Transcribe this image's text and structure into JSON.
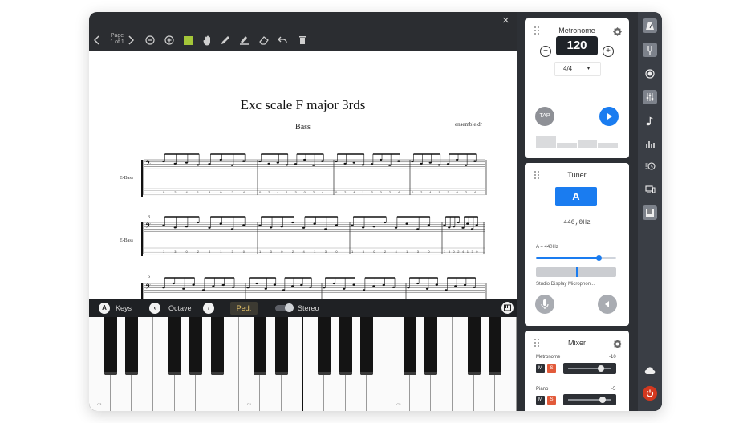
{
  "editor": {
    "page_label": "Page",
    "page_number": "1 of 1",
    "close_glyph": "×",
    "score": {
      "title": "Exc scale F major 3rds",
      "subtitle": "Bass",
      "credit": "ensemble.dr",
      "instrument_labels": [
        "E-Bass",
        "E-Bass"
      ],
      "measure_numbers": [
        "3",
        "5"
      ]
    },
    "tools": [
      "chevron-left-icon",
      "chevron-right-icon",
      "zoom-out-icon",
      "zoom-in-icon",
      "color-swatch-icon",
      "hand-icon",
      "pen-icon",
      "highlighter-icon",
      "eraser-icon",
      "undo-icon",
      "trash-icon"
    ],
    "tool_colors": {
      "swatch": "#a4c639"
    }
  },
  "piano_bar": {
    "keys_button": "A",
    "keys_label": "Keys",
    "octave_label": "Octave",
    "octave_prev": "‹",
    "octave_next": "›",
    "pedal_label": "Ped.",
    "stereo_label": "Stereo",
    "stereo_on": true
  },
  "keyboard": {
    "white_key_count": 20,
    "labels": [
      "C3",
      "C4",
      "C5",
      "C6"
    ]
  },
  "metronome": {
    "title": "Metronome",
    "bpm": "120",
    "minus": "−",
    "plus": "+",
    "time_signature": "4/4",
    "tap_label": "TAP",
    "beats": [
      0.7,
      0.3,
      0.45,
      0.3
    ]
  },
  "tuner": {
    "title": "Tuner",
    "note": "A",
    "frequency": "440,0Hz",
    "reference_label": "A = 440Hz",
    "reference_level": 0.78,
    "input_level": 0.5,
    "device_label": "Studio Display Microphon..."
  },
  "mixer": {
    "title": "Mixer",
    "channels": [
      {
        "name": "Metronome",
        "db": "-10",
        "mute": "M",
        "solo": "S",
        "level": 0.75
      },
      {
        "name": "Piano",
        "db": "-5",
        "mute": "M",
        "solo": "S",
        "level": 0.8
      }
    ]
  },
  "sidebar": {
    "items": [
      "metronome-icon",
      "tuning-fork-icon",
      "record-icon",
      "mixer-icon",
      "note-icon",
      "bars-icon",
      "history-icon",
      "devices-icon",
      "piano-icon",
      "cloud-icon",
      "power-icon"
    ]
  },
  "colors": {
    "accent": "#1a7cf0",
    "solo": "#e25a3a",
    "power": "#d3381f"
  }
}
